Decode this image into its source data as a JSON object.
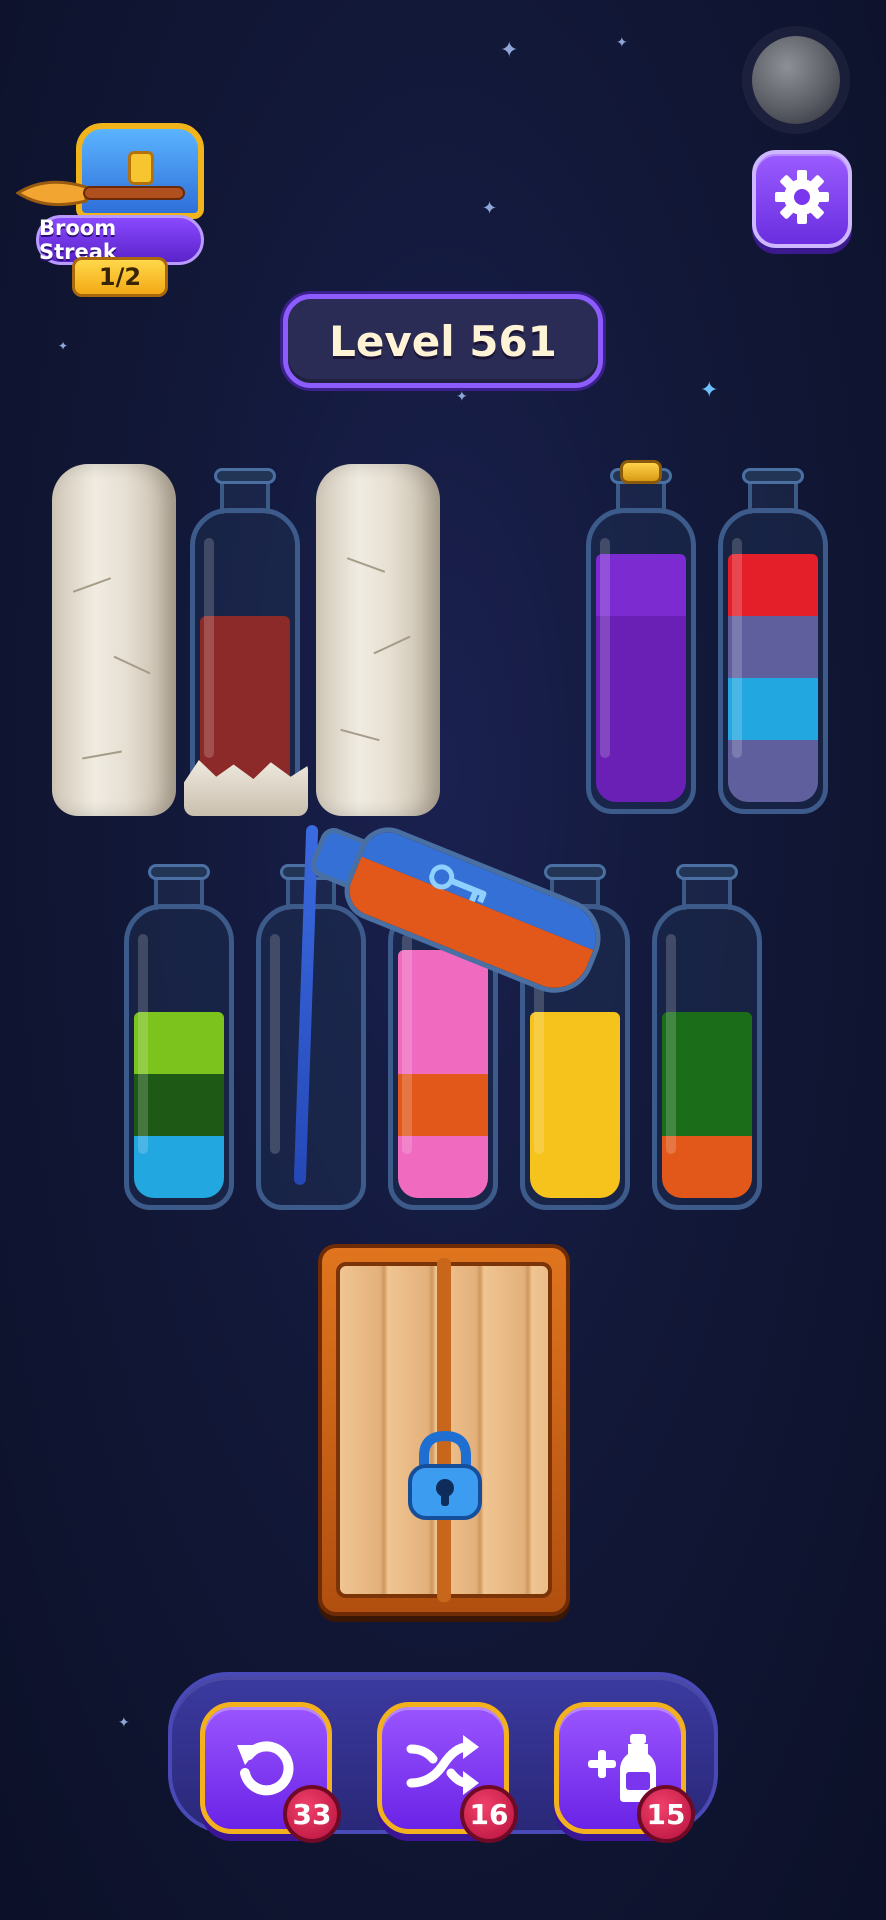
{
  "streak": {
    "label": "Broom Streak",
    "count": "1/2"
  },
  "level": {
    "label": "Level 561"
  },
  "icons": {
    "settings": "gear-icon",
    "undo": "undo-icon",
    "shuffle": "shuffle-icon",
    "add_bottle": "add-bottle-icon",
    "padlock": "padlock-icon",
    "key": "key-icon"
  },
  "colors": {
    "purple": "#6a1fb5",
    "red": "#e51f2a",
    "slate": "#5f5f9e",
    "cyan": "#22a7e0",
    "lime": "#7cc31e",
    "darkgreen": "#1e5a16",
    "pink": "#f06bbf",
    "orange": "#e1581a",
    "yellow": "#f6c21c",
    "green": "#1c6d1a",
    "maroon": "#8b2a28",
    "blue": "#3470d6"
  },
  "board": {
    "top_row": [
      {
        "kind": "stone"
      },
      {
        "kind": "bottle",
        "cracked": true,
        "layers": [
          "maroon",
          "maroon",
          "maroon"
        ]
      },
      {
        "kind": "stone"
      },
      {
        "kind": "bottle",
        "corked": true,
        "layers": [
          "purple",
          "purple",
          "purple",
          "purple"
        ]
      },
      {
        "kind": "bottle",
        "layers": [
          "slate",
          "cyan",
          "slate",
          "red"
        ]
      }
    ],
    "bottom_row": [
      {
        "kind": "bottle",
        "layers": [
          "cyan",
          "darkgreen",
          "lime"
        ]
      },
      {
        "kind": "bottle",
        "layers": []
      },
      {
        "kind": "bottle",
        "layers": [
          "pink",
          "orange",
          "pink",
          "pink"
        ]
      },
      {
        "kind": "bottle",
        "layers": [
          "yellow",
          "yellow",
          "yellow"
        ]
      },
      {
        "kind": "bottle",
        "layers": [
          "orange",
          "green",
          "green"
        ]
      }
    ],
    "pouring_bottle": {
      "layers": [
        "blue",
        "orange"
      ],
      "has_key": true
    },
    "locked_door": {
      "locked": true
    }
  },
  "tools": [
    {
      "id": "undo",
      "count": "33"
    },
    {
      "id": "shuffle",
      "count": "16"
    },
    {
      "id": "add_bottle",
      "count": "15"
    }
  ]
}
